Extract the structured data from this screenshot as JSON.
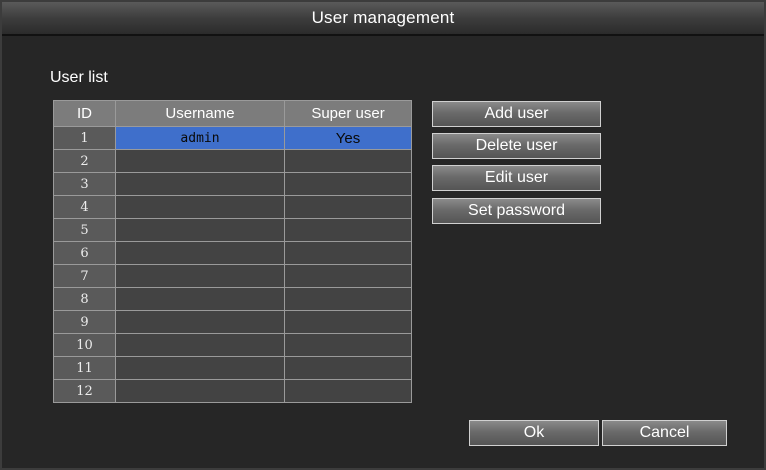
{
  "window": {
    "title": "User management"
  },
  "user_list": {
    "label": "User list",
    "columns": [
      "ID",
      "Username",
      "Super user"
    ],
    "rows": [
      {
        "id": "1",
        "username": "admin",
        "super_user": "Yes",
        "selected": true
      },
      {
        "id": "2",
        "username": "",
        "super_user": ""
      },
      {
        "id": "3",
        "username": "",
        "super_user": ""
      },
      {
        "id": "4",
        "username": "",
        "super_user": ""
      },
      {
        "id": "5",
        "username": "",
        "super_user": ""
      },
      {
        "id": "6",
        "username": "",
        "super_user": ""
      },
      {
        "id": "7",
        "username": "",
        "super_user": ""
      },
      {
        "id": "8",
        "username": "",
        "super_user": ""
      },
      {
        "id": "9",
        "username": "",
        "super_user": ""
      },
      {
        "id": "10",
        "username": "",
        "super_user": ""
      },
      {
        "id": "11",
        "username": "",
        "super_user": ""
      },
      {
        "id": "12",
        "username": "",
        "super_user": ""
      }
    ]
  },
  "actions": {
    "add_user": "Add user",
    "delete_user": "Delete user",
    "edit_user": "Edit user",
    "set_password": "Set password"
  },
  "footer": {
    "ok": "Ok",
    "cancel": "Cancel"
  },
  "colors": {
    "selection": "#3f6fcb",
    "header_bg": "#7c7c7c",
    "window_bg": "#262626"
  }
}
